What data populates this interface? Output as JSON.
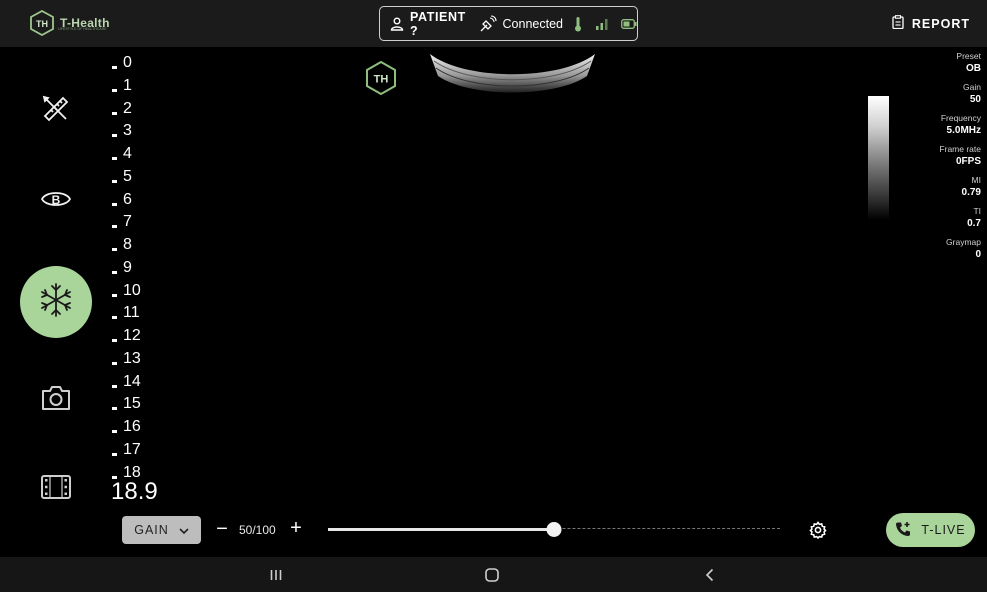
{
  "app": {
    "logo_text": "T-Health",
    "logo_monogram": "TH",
    "logo_subtitle": "LIFESTYLE OF HEALTHCARE"
  },
  "header": {
    "patient_label": "PATIENT ?",
    "connection_status": "Connected",
    "report_label": "REPORT"
  },
  "tools": [
    {
      "name": "measure",
      "icon": "ruler-pencil-icon"
    },
    {
      "name": "bmode",
      "icon": "b-mode-icon"
    },
    {
      "name": "freeze",
      "icon": "snowflake-icon",
      "active": true
    },
    {
      "name": "capture",
      "icon": "camera-icon"
    },
    {
      "name": "cine",
      "icon": "film-icon"
    }
  ],
  "depth": {
    "labels": [
      "0",
      "1",
      "2",
      "3",
      "4",
      "5",
      "6",
      "7",
      "8",
      "9",
      "10",
      "11",
      "12",
      "13",
      "14",
      "15",
      "16",
      "17",
      "18"
    ],
    "max": "18.9"
  },
  "params": [
    {
      "label": "Preset",
      "value": "OB"
    },
    {
      "label": "Gain",
      "value": "50"
    },
    {
      "label": "Frequency",
      "value": "5.0MHz"
    },
    {
      "label": "Frame rate",
      "value": "0FPS"
    },
    {
      "label": "MI",
      "value": "0.79"
    },
    {
      "label": "TI",
      "value": "0.7"
    },
    {
      "label": "Graymap",
      "value": "0"
    }
  ],
  "controls": {
    "mode_label": "GAIN",
    "minus": "−",
    "plus": "+",
    "value_text": "50/100",
    "slider_value": 0.5,
    "tlive_label": "T-LIVE"
  },
  "colors": {
    "accent": "#a9d49a",
    "topbar": "#1b1b1b",
    "navbar": "#161616"
  }
}
